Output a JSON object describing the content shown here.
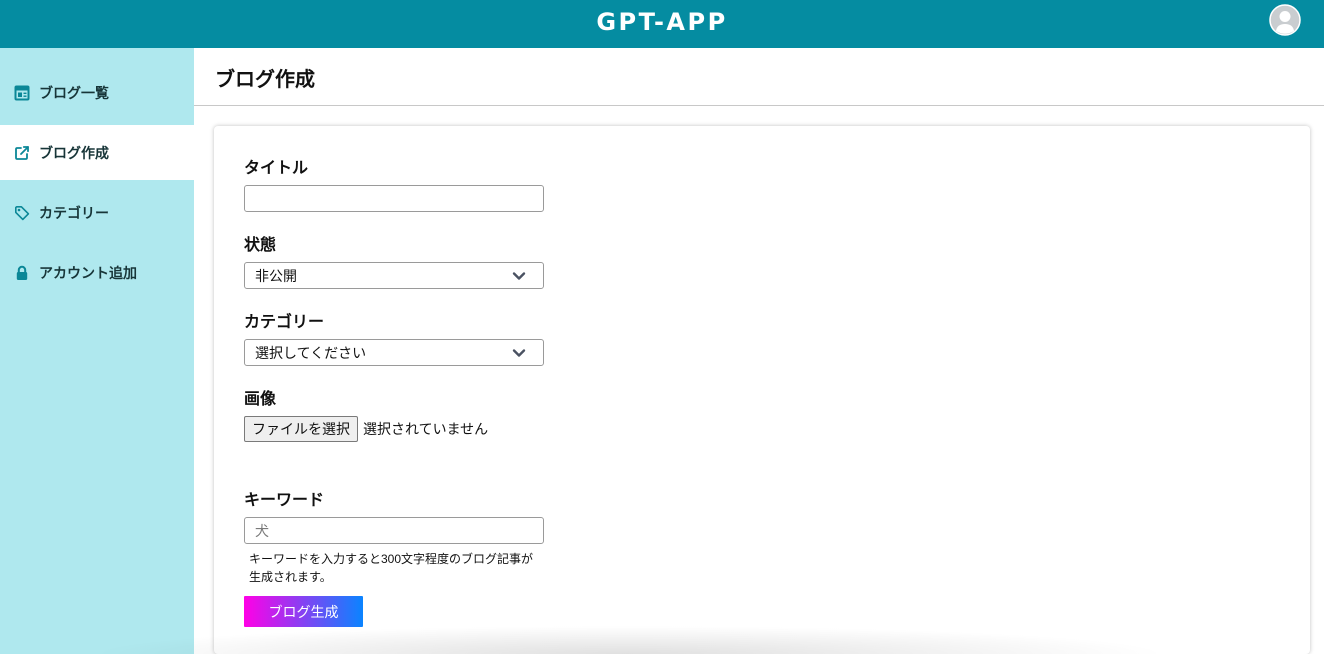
{
  "header": {
    "title": "GPT-APP",
    "avatar_icon": "user-avatar-icon"
  },
  "sidebar": {
    "items": [
      {
        "label": "ブログ一覧",
        "icon": "list-icon",
        "active": false
      },
      {
        "label": "ブログ作成",
        "icon": "edit-icon",
        "active": true
      },
      {
        "label": "カテゴリー",
        "icon": "tag-icon",
        "active": false
      },
      {
        "label": "アカウント追加",
        "icon": "lock-icon",
        "active": false
      }
    ]
  },
  "page": {
    "title": "ブログ作成"
  },
  "form": {
    "title": {
      "label": "タイトル",
      "value": ""
    },
    "status": {
      "label": "状態",
      "value": "非公開",
      "icon": "chevron-down-icon"
    },
    "category": {
      "label": "カテゴリー",
      "value": "選択してください",
      "icon": "chevron-down-icon"
    },
    "image": {
      "label": "画像",
      "button_label": "ファイルを選択",
      "file_status": "選択されていません"
    },
    "keyword": {
      "label": "キーワード",
      "value": "",
      "placeholder": "犬",
      "help_text": "キーワードを入力すると300文字程度のブログ記事が生成されます。"
    },
    "generate_button": {
      "label": "ブログ生成"
    }
  },
  "theme": {
    "header_bg": "#058ca1",
    "sidebar_bg": "#afe8ee",
    "sidebar_icon": "#0b8797",
    "active_item_bg": "#ffffff",
    "generate_gradient_start": "#ff00e6",
    "generate_gradient_end": "#0a84ff"
  }
}
